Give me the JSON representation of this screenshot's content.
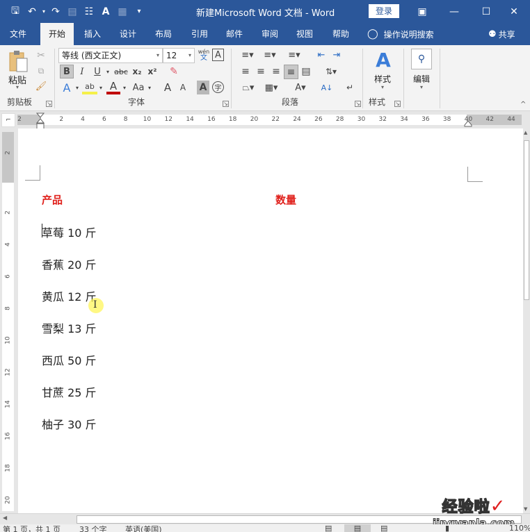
{
  "titlebar": {
    "title": "新建Microsoft Word 文档  -  Word",
    "login_label": "登录",
    "qat_icons": [
      "save-icon",
      "undo-icon",
      "redo-icon",
      "touch-mode-icon",
      "form-icon",
      "spelling-icon",
      "table-icon",
      "customize-icon"
    ]
  },
  "tabs": [
    {
      "label": "文件",
      "active": false
    },
    {
      "label": "开始",
      "active": true
    },
    {
      "label": "插入",
      "active": false
    },
    {
      "label": "设计",
      "active": false
    },
    {
      "label": "布局",
      "active": false
    },
    {
      "label": "引用",
      "active": false
    },
    {
      "label": "邮件",
      "active": false
    },
    {
      "label": "审阅",
      "active": false
    },
    {
      "label": "视图",
      "active": false
    },
    {
      "label": "帮助",
      "active": false
    }
  ],
  "tell_me": "操作说明搜索",
  "share_label": "共享",
  "ribbon": {
    "clipboard": {
      "paste_label": "粘贴",
      "group_label": "剪贴板"
    },
    "font": {
      "font_name": "等线 (西文正文)",
      "font_size": "12",
      "group_label": "字体",
      "phonetic_label": "wén",
      "phonetic_char": "文",
      "bold": "B",
      "italic": "I",
      "underline": "U",
      "strike": "abc",
      "subscript": "x₂",
      "superscript": "x²",
      "grow": "A",
      "shrink": "A",
      "case": "Aa",
      "shade": "A",
      "enclose": "字"
    },
    "paragraph": {
      "group_label": "段落"
    },
    "styles": {
      "label": "样式",
      "group_label": "样式"
    },
    "editing": {
      "label": "编辑"
    }
  },
  "ruler": {
    "h_ticks": [
      "2",
      "2",
      "4",
      "6",
      "8",
      "10",
      "12",
      "14",
      "16",
      "18",
      "20",
      "22",
      "24",
      "26",
      "28",
      "30",
      "32",
      "34",
      "36",
      "38",
      "40",
      "42",
      "44"
    ],
    "v_ticks": [
      "2",
      "2",
      "4",
      "6",
      "8",
      "10",
      "12",
      "14",
      "16",
      "18",
      "20"
    ]
  },
  "document": {
    "headers": [
      "产品",
      "数量"
    ],
    "lines": [
      "草莓 10 斤",
      "香蕉 20 斤",
      "黄瓜 12 斤",
      "雪梨 13 斤",
      "西瓜 50 斤",
      "甘蔗 25 斤",
      "柚子 30 斤"
    ]
  },
  "status": {
    "page": "第 1 页，共 1 页",
    "words": "33 个字",
    "language": "英语(美国)",
    "zoom": "110%"
  },
  "watermark": {
    "line1": "经验啦",
    "check": "✓",
    "line2": "jingyanla.com"
  },
  "colors": {
    "brand": "#2b579a",
    "header_red": "#e0201b"
  }
}
